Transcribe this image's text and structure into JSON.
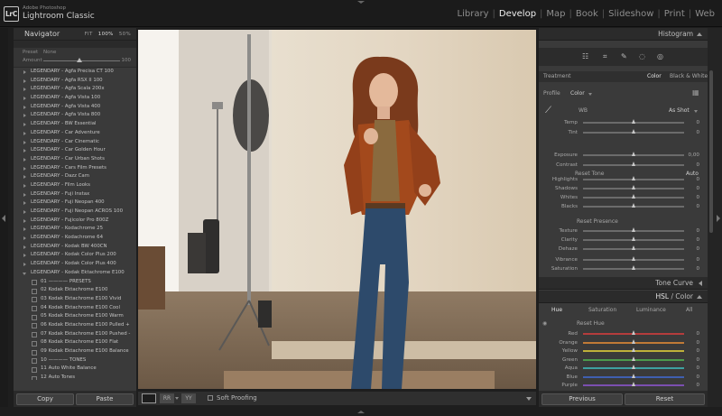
{
  "app": {
    "brand_line1": "Adobe Photoshop",
    "brand_line2": "Lightroom Classic",
    "logo": "LrC"
  },
  "modules": [
    {
      "label": "Library",
      "active": false
    },
    {
      "label": "Develop",
      "active": true
    },
    {
      "label": "Map",
      "active": false
    },
    {
      "label": "Book",
      "active": false
    },
    {
      "label": "Slideshow",
      "active": false
    },
    {
      "label": "Print",
      "active": false
    },
    {
      "label": "Web",
      "active": false
    }
  ],
  "navigator": {
    "title": "Navigator",
    "zoom_fit": "FIT",
    "zoom_100": "100%",
    "zoom_50": "50%"
  },
  "preset_bar": {
    "preset_label": "Preset",
    "preset_value": "None",
    "amount_label": "Amount",
    "amount_value": "100"
  },
  "presets": [
    {
      "label": "LEGENDARY - Agfa Precisa CT 100",
      "type": "folder"
    },
    {
      "label": "LEGENDARY - Agfa RSX II 100",
      "type": "folder"
    },
    {
      "label": "LEGENDARY - Agfa Scala 200x",
      "type": "folder"
    },
    {
      "label": "LEGENDARY - Agfa Vista 100",
      "type": "folder"
    },
    {
      "label": "LEGENDARY - Agfa Vista 400",
      "type": "folder"
    },
    {
      "label": "LEGENDARY - Agfa Vista 800",
      "type": "folder"
    },
    {
      "label": "LEGENDARY - BW Essential",
      "type": "folder"
    },
    {
      "label": "LEGENDARY - Car Adventure",
      "type": "folder"
    },
    {
      "label": "LEGENDARY - Car Cinematic",
      "type": "folder"
    },
    {
      "label": "LEGENDARY - Car Golden Hour",
      "type": "folder"
    },
    {
      "label": "LEGENDARY - Car Urban Shots",
      "type": "folder"
    },
    {
      "label": "LEGENDARY - Cars Film Presets",
      "type": "folder"
    },
    {
      "label": "LEGENDARY - Dazz Cam",
      "type": "folder"
    },
    {
      "label": "LEGENDARY - Film Looks",
      "type": "folder"
    },
    {
      "label": "LEGENDARY - Fuji Instax",
      "type": "folder"
    },
    {
      "label": "LEGENDARY - Fuji Neopan 400",
      "type": "folder"
    },
    {
      "label": "LEGENDARY - Fuji Neopan ACROS 100",
      "type": "folder"
    },
    {
      "label": "LEGENDARY - Fujicolor Pro 800Z",
      "type": "folder"
    },
    {
      "label": "LEGENDARY - Kodachrome 25",
      "type": "folder"
    },
    {
      "label": "LEGENDARY - Kodachrome 64",
      "type": "folder"
    },
    {
      "label": "LEGENDARY - Kodak BW 400CN",
      "type": "folder"
    },
    {
      "label": "LEGENDARY - Kodak Color Plus 200",
      "type": "folder"
    },
    {
      "label": "LEGENDARY - Kodak Color Plus 400",
      "type": "folder"
    },
    {
      "label": "LEGENDARY - Kodak Ektachrome E100",
      "type": "open"
    },
    {
      "label": "01 ———— PRESETS",
      "type": "item"
    },
    {
      "label": "02 Kodak Ektachrome E100",
      "type": "item"
    },
    {
      "label": "03 Kodak Ektachrome E100 Vivid",
      "type": "item"
    },
    {
      "label": "04 Kodak Ektachrome E100 Cool",
      "type": "item"
    },
    {
      "label": "05 Kodak Ektachrome E100 Warm",
      "type": "item"
    },
    {
      "label": "06 Kodak Ektachrome E100 Pulled +",
      "type": "item"
    },
    {
      "label": "07 Kodak Ektachrome E100 Pushed -",
      "type": "item"
    },
    {
      "label": "08 Kodak Ektachrome E100 Flat",
      "type": "item"
    },
    {
      "label": "09 Kodak Ektachrome E100 Balance",
      "type": "item"
    },
    {
      "label": "10 ———— TONES",
      "type": "item"
    },
    {
      "label": "11 Auto White Balance",
      "type": "item"
    },
    {
      "label": "12 Auto Tones",
      "type": "item"
    }
  ],
  "left_buttons": {
    "copy": "Copy",
    "paste": "Paste"
  },
  "toolbar": {
    "soft_proofing": "Soft Proofing"
  },
  "histogram": {
    "title": "Histogram"
  },
  "basic": {
    "treatment_label": "Treatment",
    "treatment_color": "Color",
    "treatment_bw": "Black & White",
    "profile_label": "Profile",
    "profile_value": "Color",
    "wb_label": "WB",
    "wb_value": "As Shot",
    "reset_tone": "Reset Tone",
    "auto": "Auto",
    "reset_presence": "Reset Presence",
    "wb_sliders": [
      {
        "label": "Temp",
        "value": "0",
        "pos": 0.5
      },
      {
        "label": "Tint",
        "value": "0",
        "pos": 0.5
      }
    ],
    "tone_sliders": [
      {
        "label": "Exposure",
        "value": "0,00",
        "pos": 0.5
      },
      {
        "label": "Contrast",
        "value": "0",
        "pos": 0.5
      },
      {
        "label": "Highlights",
        "value": "0",
        "pos": 0.5
      },
      {
        "label": "Shadows",
        "value": "0",
        "pos": 0.5
      },
      {
        "label": "Whites",
        "value": "0",
        "pos": 0.5
      },
      {
        "label": "Blacks",
        "value": "0",
        "pos": 0.5
      }
    ],
    "presence_sliders": [
      {
        "label": "Texture",
        "value": "0",
        "pos": 0.5
      },
      {
        "label": "Clarity",
        "value": "0",
        "pos": 0.5
      },
      {
        "label": "Dehaze",
        "value": "0",
        "pos": 0.5
      },
      {
        "label": "Vibrance",
        "value": "0",
        "pos": 0.5
      },
      {
        "label": "Saturation",
        "value": "0",
        "pos": 0.5
      }
    ]
  },
  "tone_curve": {
    "title": "Tone Curve"
  },
  "hsl": {
    "title_hsl": "HSL",
    "title_sep": "/",
    "title_color": "Color",
    "tabs": [
      "Hue",
      "Saturation",
      "Luminance",
      "All"
    ],
    "reset": "Reset Hue",
    "sliders": [
      {
        "label": "Red",
        "value": "0",
        "color": "#b43c3c"
      },
      {
        "label": "Orange",
        "value": "0",
        "color": "#c07a36"
      },
      {
        "label": "Yellow",
        "value": "0",
        "color": "#bfb03a"
      },
      {
        "label": "Green",
        "value": "0",
        "color": "#4c9a4c"
      },
      {
        "label": "Aqua",
        "value": "0",
        "color": "#3ea0a0"
      },
      {
        "label": "Blue",
        "value": "0",
        "color": "#3f5fb0"
      },
      {
        "label": "Purple",
        "value": "0",
        "color": "#7b4fb0"
      }
    ]
  },
  "right_buttons": {
    "previous": "Previous",
    "reset": "Reset"
  }
}
